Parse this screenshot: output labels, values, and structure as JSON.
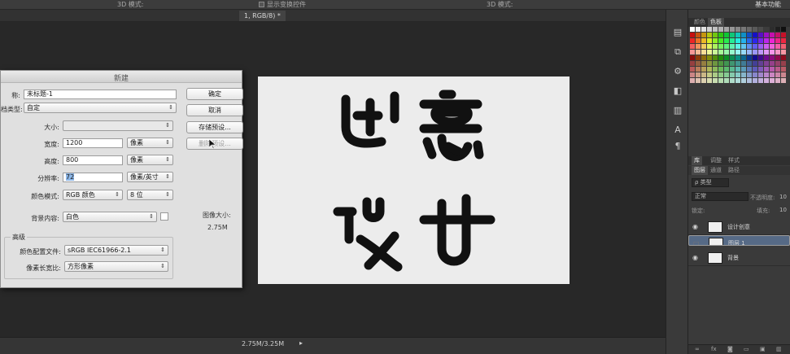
{
  "options_bar": {
    "show_transform": "显示变换控件",
    "mode_3d_1": "3D 模式:",
    "mode_3d_2": "3D 模式:",
    "workspace": "基本功能"
  },
  "document": {
    "tab_label": "1, RGB/8) *",
    "status": "2.75M/3.25M",
    "status_arrow": "▸",
    "artwork_lines": [
      "创意",
      "设计"
    ]
  },
  "dialog": {
    "title": "新建",
    "name_label": "称:",
    "name_value": "未标题-1",
    "preset_label": "档类型:",
    "preset_value": "自定",
    "size_label": "大小:",
    "size_value": "",
    "width_label": "宽度:",
    "width_value": "1200",
    "width_unit": "像素",
    "height_label": "高度:",
    "height_value": "800",
    "height_unit": "像素",
    "resolution_label": "分辨率:",
    "resolution_value": "72",
    "resolution_unit": "像素/英寸",
    "color_mode_label": "颜色模式:",
    "color_mode_value": "RGB 颜色",
    "bit_depth": "8 位",
    "background_label": "背景内容:",
    "background_value": "白色",
    "advanced_label": "高级",
    "color_profile_label": "颜色配置文件:",
    "color_profile_value": "sRGB IEC61966-2.1",
    "pixel_aspect_label": "像素长宽比:",
    "pixel_aspect_value": "方形像素",
    "image_size_label": "图像大小:",
    "image_size_value": "2.75M",
    "buttons": {
      "ok": "确定",
      "cancel": "取消",
      "save_preset": "存储预设...",
      "delete_preset": "删除预设..."
    }
  },
  "panels": {
    "color_tabs": [
      "颜色",
      "色板"
    ],
    "layer_tabs": [
      "库",
      "调整",
      "样式"
    ],
    "layer_subtabs": [
      "图层",
      "通道",
      "路径"
    ],
    "kind_filter": "ρ 类型",
    "blend_mode": "正常",
    "opacity_label": "不透明度:",
    "opacity_value": "10",
    "lock_label": "锁定:",
    "fill_label": "填充:",
    "fill_value": "10",
    "layers": [
      {
        "name": "设计创意",
        "visible": true,
        "selected": false
      },
      {
        "name": "图层 1",
        "visible": false,
        "selected": true
      },
      {
        "name": "背景",
        "visible": true,
        "selected": false
      }
    ]
  },
  "colors": {
    "panel_dark": "#3a3a3a",
    "workspace": "#282828",
    "artboard": "#ececec",
    "dialog_bg": "#e0e0e0",
    "selection": "#566a86",
    "artwork_stroke": "#111111"
  }
}
